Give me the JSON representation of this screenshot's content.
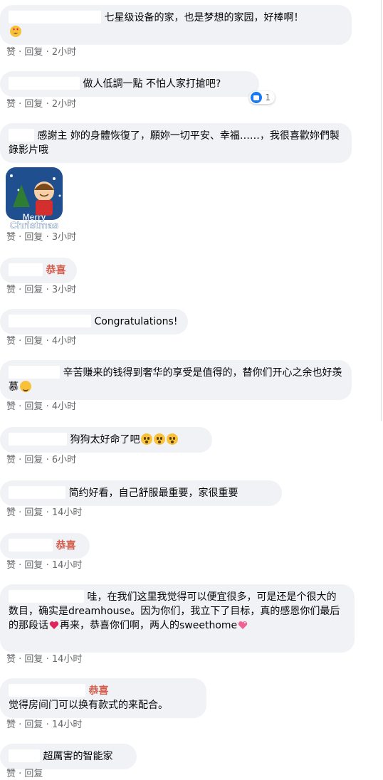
{
  "actions": {
    "like": "赞",
    "reply": "回复",
    "sep": " · "
  },
  "sticker": {
    "line1": "Merry",
    "line2": "Christmas"
  },
  "comments": [
    {
      "text": "七星级设备的家，也是梦想的家园，好棒啊！",
      "time": "2小时"
    },
    {
      "text": "做人低調一點 不怕人家打搶吧?",
      "time": "2小时",
      "reaction_count": "1"
    },
    {
      "text": "感謝主 妳的身體恢復了，願妳一切平安、幸福……，我很喜歡妳們製錄影片哦",
      "time": "3小时"
    },
    {
      "text": "恭喜",
      "time": "3小时"
    },
    {
      "text": "Congratulations!",
      "time": "4小时"
    },
    {
      "text": "辛苦赚来的钱得到奢华的享受是值得的，替你们开心之余也好羡慕",
      "time": "4小时"
    },
    {
      "text": "狗狗太好命了吧",
      "time": "6小时"
    },
    {
      "text": "简约好看，自己舒服最重要，家很重要",
      "time": "14小时"
    },
    {
      "text": "恭喜",
      "time": "14小时"
    },
    {
      "text_a": "哇，在我们这里我觉得可以便宜很多，可是还是个很大的数目，确实是dreamhouse。因为你们，我立下了目标，真的感恩你们最后的那段话",
      "text_b": "再来，恭喜你们啊，两人的sweethome",
      "time": "14小时"
    },
    {
      "name_tail": "恭喜",
      "text": "觉得房间门可以换有款式的来配合。",
      "time": "14小时"
    },
    {
      "text": "超厲害的智能家",
      "time": ""
    }
  ]
}
